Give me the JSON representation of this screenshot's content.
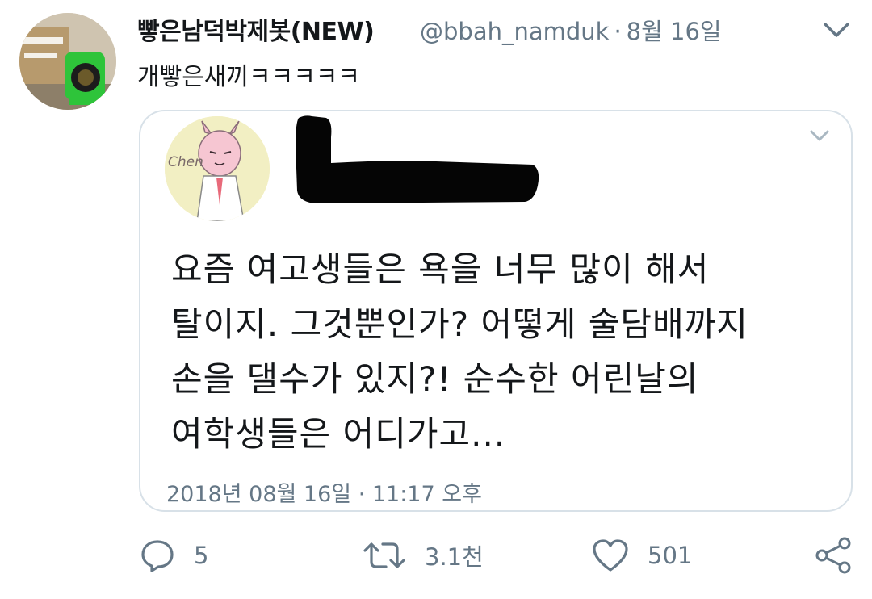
{
  "author": {
    "display_name": "빻은남덕박제봇(NEW)",
    "handle": "@bbah_namduk",
    "separator": "·",
    "date": "8월 16일"
  },
  "tweet": {
    "text": "개빻은새끼ㅋㅋㅋㅋㅋ"
  },
  "quoted": {
    "avatar_text": "Chen",
    "lines": [
      "요즘 여고생들은 욕을 너무 많이 해서",
      "탈이지. 그것뿐인가? 어떻게 술담배까지",
      "손을 댈수가 있지?! 순수한 어린날의",
      "여학생들은 어디가고..."
    ],
    "timestamp": "2018년 08월 16일 · 11:17 오후"
  },
  "actions": {
    "reply_count": "5",
    "retweet_count": "3.1천",
    "like_count": "501"
  },
  "colors": {
    "text": "#14171a",
    "secondary": "#657786",
    "border": "#d8e1e8",
    "icon": "#657786"
  },
  "icons": [
    "chevron-down-icon",
    "reply-icon",
    "retweet-icon",
    "like-icon",
    "share-icon"
  ]
}
